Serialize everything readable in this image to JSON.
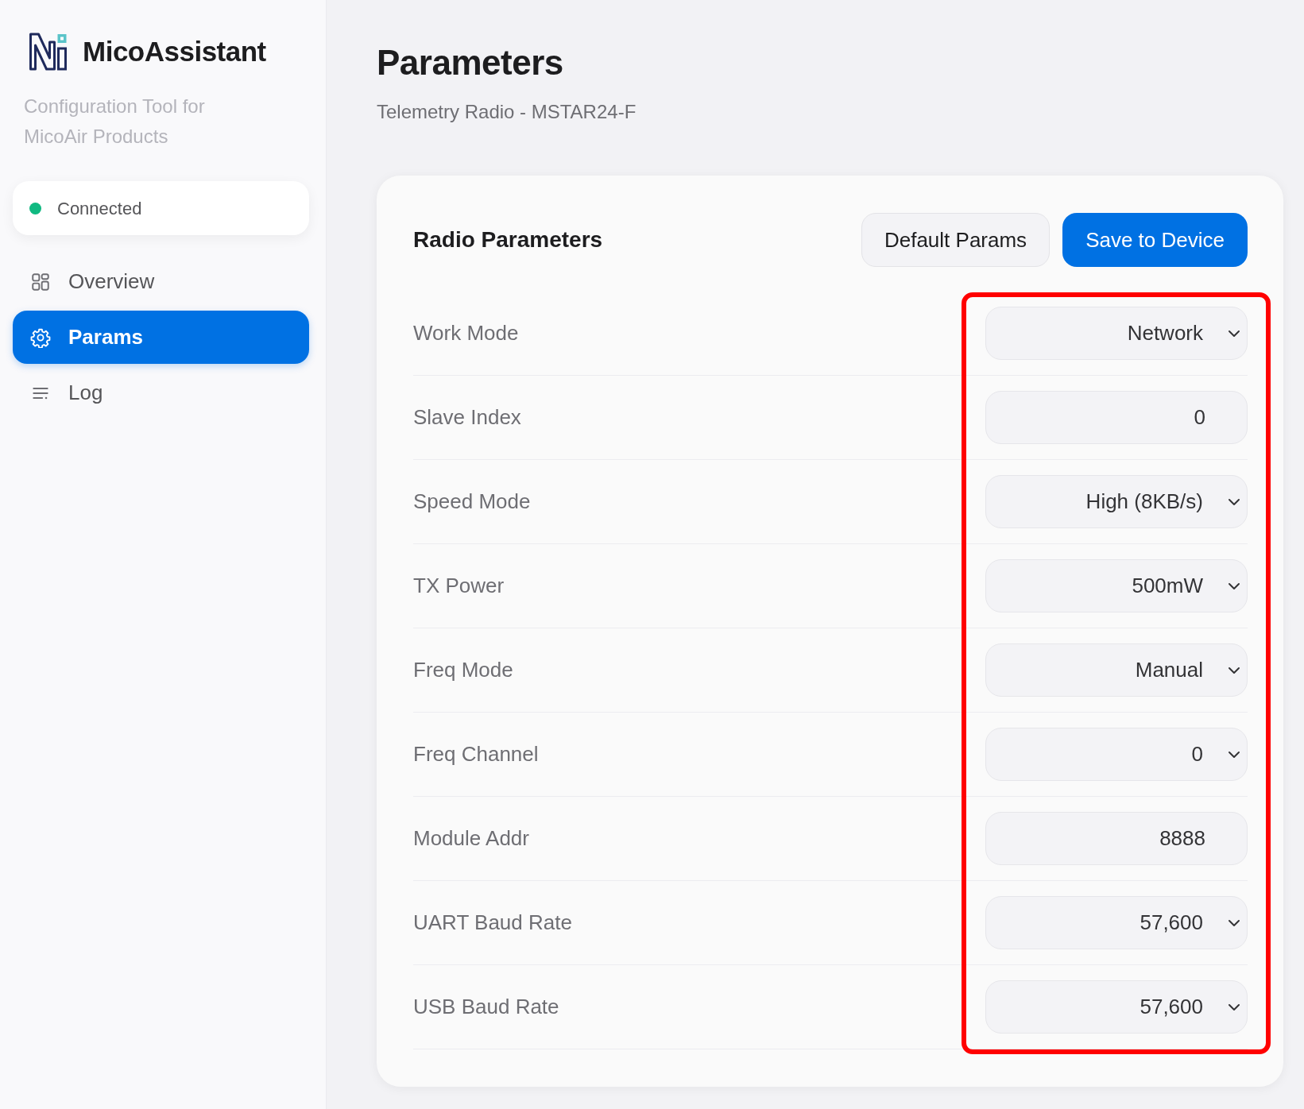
{
  "sidebar": {
    "app_name": "MicoAssistant",
    "tagline": "Configuration Tool for MicoAir Products",
    "connection": {
      "label": "Connected",
      "connected": true
    },
    "items": [
      {
        "label": "Overview",
        "selected": false
      },
      {
        "label": "Params",
        "selected": true
      },
      {
        "label": "Log",
        "selected": false
      }
    ]
  },
  "page": {
    "title": "Parameters",
    "subtitle": "Telemetry Radio - MSTAR24-F"
  },
  "card": {
    "title": "Radio Parameters",
    "buttons": [
      {
        "label": "Default Params",
        "kind": "secondary"
      },
      {
        "label": "Save to Device",
        "kind": "primary"
      }
    ],
    "highlighted": true,
    "params": [
      {
        "label": "Work Mode",
        "kind": "select",
        "value": "Network"
      },
      {
        "label": "Slave Index",
        "kind": "input",
        "value": "0"
      },
      {
        "label": "Speed Mode",
        "kind": "select",
        "value": "High (8KB/s)"
      },
      {
        "label": "TX Power",
        "kind": "select",
        "value": "500mW"
      },
      {
        "label": "Freq Mode",
        "kind": "select",
        "value": "Manual"
      },
      {
        "label": "Freq Channel",
        "kind": "select",
        "value": "0"
      },
      {
        "label": "Module Addr",
        "kind": "input",
        "value": "8888"
      },
      {
        "label": "UART Baud Rate",
        "kind": "select",
        "value": "57,600"
      },
      {
        "label": "USB Baud Rate",
        "kind": "select",
        "value": "57,600"
      }
    ]
  }
}
